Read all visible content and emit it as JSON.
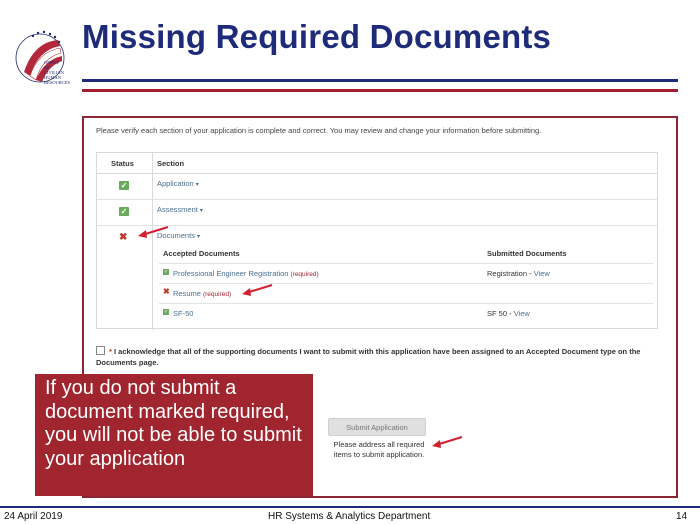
{
  "header": {
    "title": "Missing Required Documents",
    "logo_text": [
      "DEPARTMENT OF THE NAVY",
      "OFFICE",
      "OF",
      "CIVILIAN",
      "HUMAN",
      "RESOURCES"
    ]
  },
  "form": {
    "intro": "Please verify each section of your application is complete and correct. You may review and change your information before submitting.",
    "columns": {
      "status": "Status",
      "section": "Section"
    },
    "sections": [
      {
        "label": "Application",
        "status": "complete"
      },
      {
        "label": "Assessment",
        "status": "complete"
      },
      {
        "label": "Documents",
        "status": "incomplete"
      }
    ],
    "documents": {
      "col_accepted": "Accepted Documents",
      "col_submitted": "Submitted Documents",
      "rows": [
        {
          "name": "Professional Engineer Registration",
          "required": "(required)",
          "status": "complete",
          "submitted": "Registration",
          "sep": " - ",
          "link": "View"
        },
        {
          "name": "Resume",
          "required": "(required)",
          "status": "missing",
          "submitted": "",
          "link": ""
        },
        {
          "name": "SF-50",
          "required": "",
          "status": "complete",
          "submitted": "SF 50",
          "sep": " - ",
          "link": "View"
        }
      ]
    },
    "acknowledge": {
      "star": "*",
      "text": "I acknowledge that all of the supporting documents I want to submit with this application have been assigned to an Accepted Document type on the Documents page."
    },
    "submit_label": "Submit Application",
    "submit_note": "Please address all required items to submit application."
  },
  "callout": "If you do not submit a document marked required, you will not be able to submit your application",
  "footer": {
    "date": "24 April 2019",
    "department": "HR Systems & Analytics Department",
    "page": "14"
  },
  "colors": {
    "navy": "#1d2b7a",
    "maroon": "#a0252f",
    "check_green": "#6aaa5b",
    "error_red": "#c0392b",
    "link_blue": "#4a6e8f"
  }
}
